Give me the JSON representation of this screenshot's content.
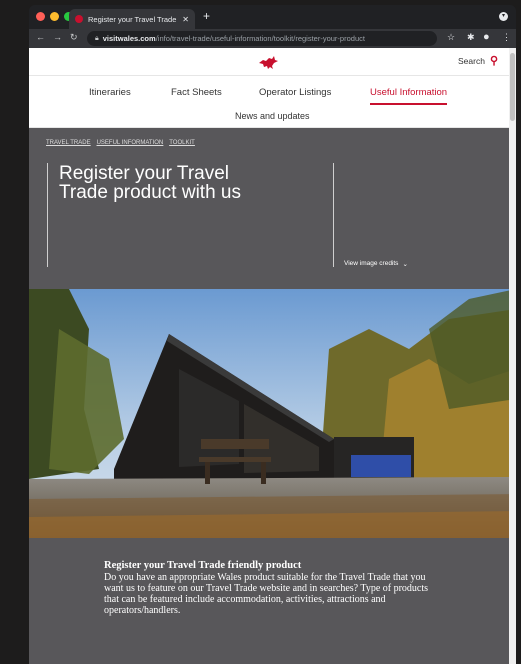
{
  "browser": {
    "tab_title": "Register your Travel Trade frie",
    "url_host": "visitwales.com",
    "url_path": "/info/travel-trade/useful-information/toolkit/register-your-product"
  },
  "header": {
    "search_label": "Search",
    "nav": [
      "Itineraries",
      "Fact Sheets",
      "Operator Listings",
      "Useful Information"
    ],
    "active_nav": "Useful Information",
    "subnav": "News and updates"
  },
  "hero": {
    "breadcrumbs": [
      "TRAVEL TRADE",
      "USEFUL INFORMATION",
      "TOOLKIT"
    ],
    "title": "Register your Travel Trade product with us",
    "credits_label": "View image credits"
  },
  "content": {
    "heading": "Register your Travel Trade friendly product",
    "paragraph": "Do you have an appropriate Wales product suitable for the Travel Trade that you want us to feature on our Travel Trade website and in searches?  Type of products that can be featured include accommodation, activities, attractions and operators/handlers."
  },
  "colors": {
    "accent": "#c8102e",
    "hero_bg": "#58575a"
  }
}
